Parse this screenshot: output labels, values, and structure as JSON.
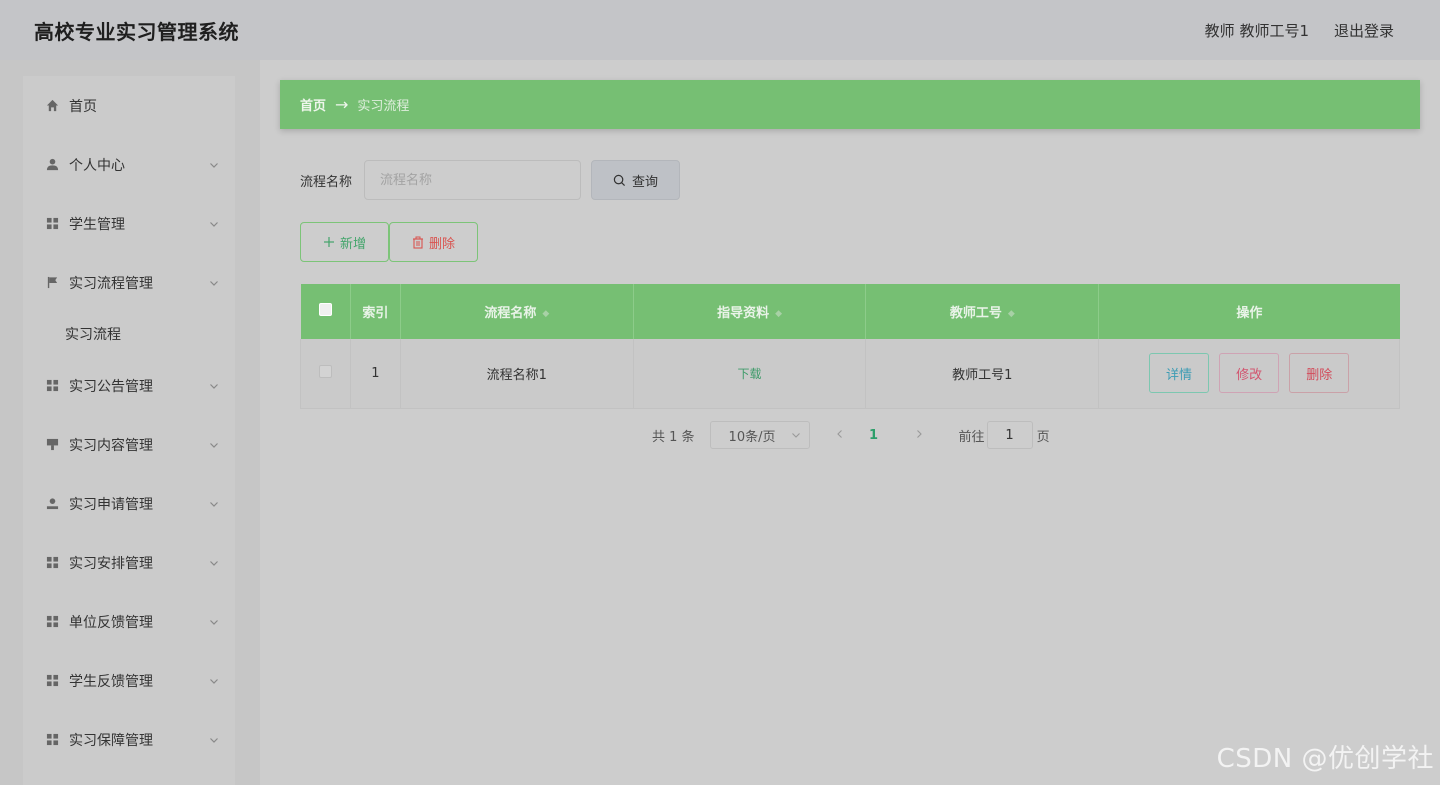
{
  "header": {
    "title": "高校专业实习管理系统",
    "user": "教师 教师工号1",
    "logout": "退出登录"
  },
  "sidebar": {
    "items": [
      {
        "label": "首页",
        "icon": "home-icon"
      },
      {
        "label": "个人中心",
        "icon": "user-icon"
      },
      {
        "label": "学生管理",
        "icon": "grid-icon"
      },
      {
        "label": "实习流程管理",
        "icon": "flag-icon"
      },
      {
        "label": "实习公告管理",
        "icon": "grid-icon"
      },
      {
        "label": "实习内容管理",
        "icon": "stamp-icon"
      },
      {
        "label": "实习申请管理",
        "icon": "person-icon"
      },
      {
        "label": "实习安排管理",
        "icon": "grid-icon"
      },
      {
        "label": "单位反馈管理",
        "icon": "grid-icon"
      },
      {
        "label": "学生反馈管理",
        "icon": "grid-icon"
      },
      {
        "label": "实习保障管理",
        "icon": "grid-icon"
      }
    ],
    "sub_item": "实习流程"
  },
  "breadcrumb": {
    "home": "首页",
    "separator": "→",
    "current": "实习流程"
  },
  "search": {
    "label": "流程名称",
    "placeholder": "流程名称",
    "value": "",
    "button": "查询"
  },
  "actions": {
    "add": "新增",
    "delete": "删除"
  },
  "table": {
    "columns": [
      "索引",
      "流程名称",
      "指导资料",
      "教师工号",
      "操作"
    ],
    "rows": [
      {
        "index": "1",
        "name": "流程名称1",
        "material": "下载",
        "teacher_id": "教师工号1"
      }
    ],
    "ops": {
      "detail": "详情",
      "edit": "修改",
      "delete": "删除"
    }
  },
  "pagination": {
    "total": "共 1 条",
    "page_size": "10条/页",
    "current_page": "1",
    "goto_label": "前往",
    "goto_value": "1",
    "goto_suffix": "页"
  },
  "watermark": "CSDN @优创学社",
  "colors": {
    "accent": "#76bf73",
    "background": "#cdcdcd"
  }
}
